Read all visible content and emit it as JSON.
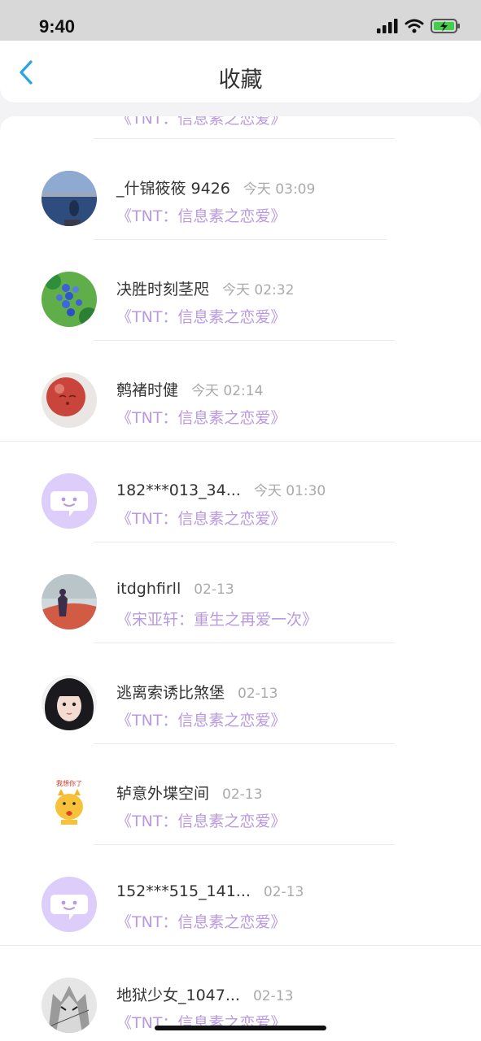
{
  "status_bar": {
    "time": "9:40"
  },
  "header": {
    "title": "收藏"
  },
  "partial_top_item": {
    "book": "《TNT：信息素之恋爱》"
  },
  "items": [
    {
      "username": "_什锦筱筱 9426",
      "time": "今天 03:09",
      "book": "《TNT：信息素之恋爱》",
      "avatar": "lake-photo-avatar"
    },
    {
      "username": "决胜时刻茎咫",
      "time": "今天 02:32",
      "book": "《TNT：信息素之恋爱》",
      "avatar": "blue-flowers-avatar"
    },
    {
      "username": "鹩褚时健",
      "time": "今天 02:14",
      "book": "《TNT：信息素之恋爱》",
      "avatar": "red-face-avatar"
    },
    {
      "username": "182***013_34...",
      "time": "今天 01:30",
      "book": "《TNT：信息素之恋爱》",
      "avatar": "default-chat-avatar"
    },
    {
      "username": "itdghfirll",
      "time": "02-13",
      "book": "《宋亚轩：重生之再爱一次》",
      "avatar": "sky-figure-avatar"
    },
    {
      "username": "逃离索诱比煞堡",
      "time": "02-13",
      "book": "《TNT：信息素之恋爱》",
      "avatar": "girl-portrait-avatar"
    },
    {
      "username": "轳意外堞空间",
      "time": "02-13",
      "book": "《TNT：信息素之恋爱》",
      "avatar": "cartoon-cat-avatar"
    },
    {
      "username": "152***515_141...",
      "time": "02-13",
      "book": "《TNT：信息素之恋爱》",
      "avatar": "default-chat-avatar"
    },
    {
      "username": "地狱少女_1047...",
      "time": "02-13",
      "book": "《TNT：信息素之恋爱》",
      "avatar": "anime-wolf-avatar"
    }
  ],
  "sticker_text": "我想你了",
  "colors": {
    "accent": "#b99ae0",
    "back_arrow": "#2aa3e6",
    "default_avatar_bg": "#dccdfa"
  }
}
